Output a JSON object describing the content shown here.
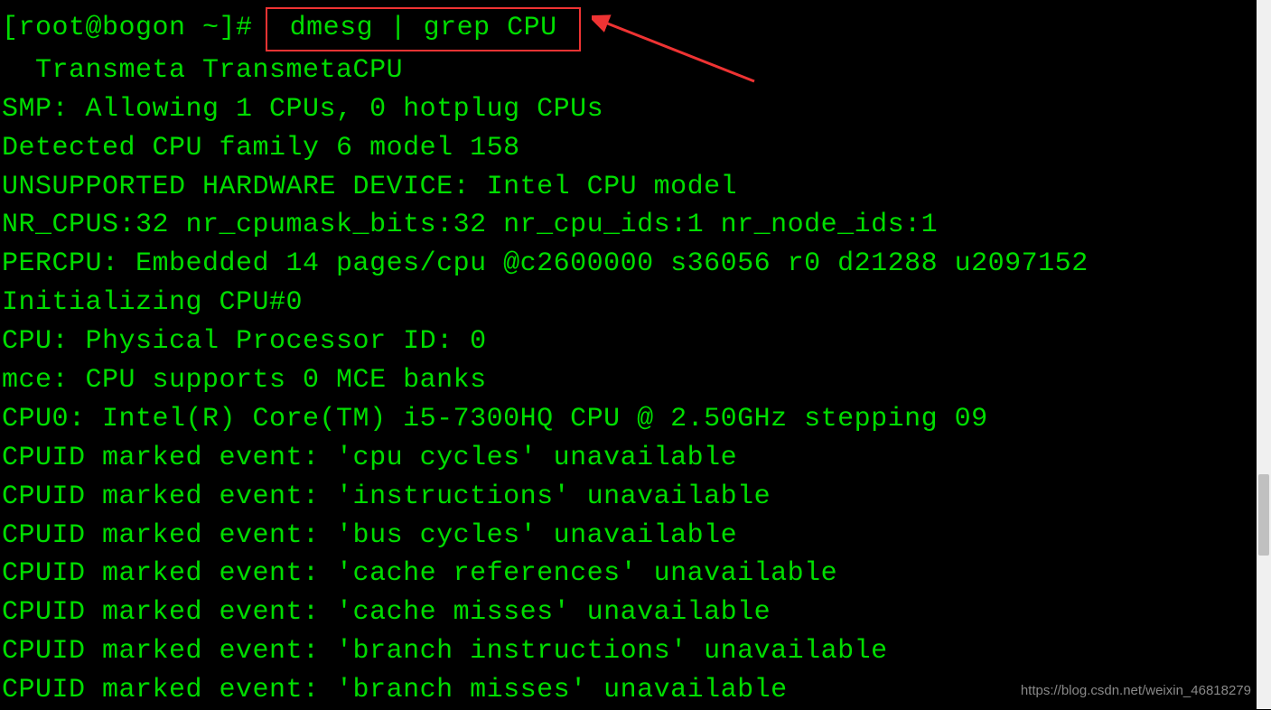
{
  "colors": {
    "background": "#000000",
    "text": "#00dd00",
    "highlight_box": "#ee3333",
    "arrow": "#ee3333",
    "scrollbar_track": "#f0f0f0",
    "scrollbar_thumb": "#c0c0c0",
    "watermark": "#888888"
  },
  "prompt": {
    "full": "[root@bogon ~]#",
    "user": "root",
    "host": "bogon",
    "cwd": "~",
    "symbol": "#"
  },
  "command": " dmesg | grep CPU ",
  "output": [
    "  Transmeta TransmetaCPU",
    "SMP: Allowing 1 CPUs, 0 hotplug CPUs",
    "Detected CPU family 6 model 158",
    "UNSUPPORTED HARDWARE DEVICE: Intel CPU model",
    "NR_CPUS:32 nr_cpumask_bits:32 nr_cpu_ids:1 nr_node_ids:1",
    "PERCPU: Embedded 14 pages/cpu @c2600000 s36056 r0 d21288 u2097152",
    "Initializing CPU#0",
    "CPU: Physical Processor ID: 0",
    "mce: CPU supports 0 MCE banks",
    "CPU0: Intel(R) Core(TM) i5-7300HQ CPU @ 2.50GHz stepping 09",
    "CPUID marked event: 'cpu cycles' unavailable",
    "CPUID marked event: 'instructions' unavailable",
    "CPUID marked event: 'bus cycles' unavailable",
    "CPUID marked event: 'cache references' unavailable",
    "CPUID marked event: 'cache misses' unavailable",
    "CPUID marked event: 'branch instructions' unavailable",
    "CPUID marked event: 'branch misses' unavailable"
  ],
  "watermark": "https://blog.csdn.net/weixin_46818279"
}
